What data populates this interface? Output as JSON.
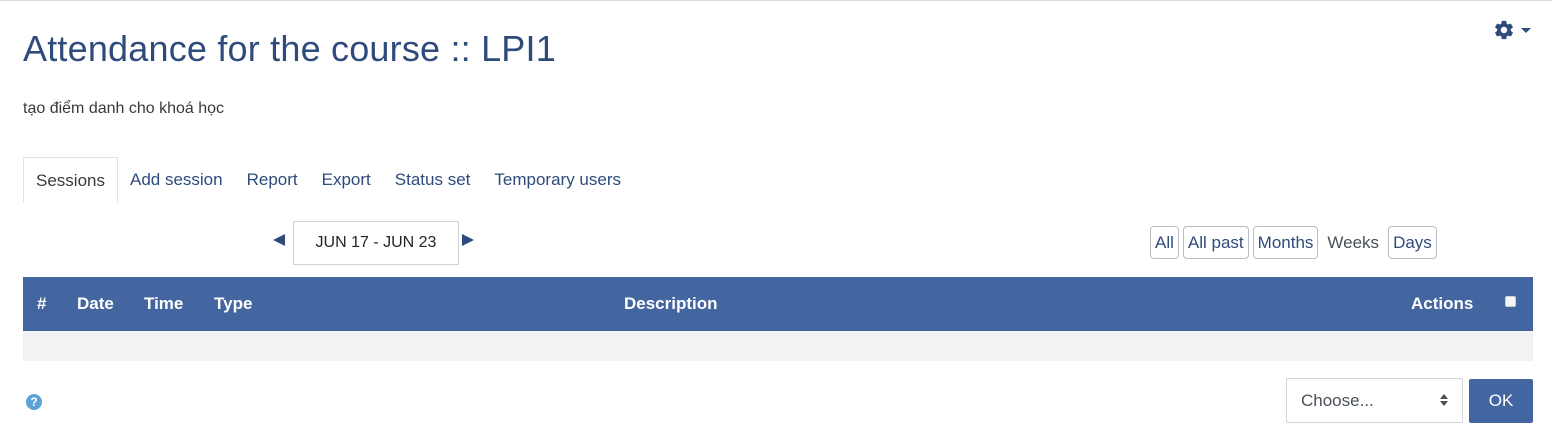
{
  "page": {
    "title": "Attendance for the course :: LPI1",
    "subtitle": "tạo điểm danh cho khoá học"
  },
  "tabs": [
    {
      "label": "Sessions",
      "active": true
    },
    {
      "label": "Add session"
    },
    {
      "label": "Report"
    },
    {
      "label": "Export"
    },
    {
      "label": "Status set"
    },
    {
      "label": "Temporary users"
    }
  ],
  "date_nav": {
    "current_range": "JUN 17 - JUN 23"
  },
  "view_options": {
    "all": "All",
    "all_past": "All past",
    "months": "Months",
    "weeks": "Weeks",
    "days": "Days",
    "selected": "Weeks"
  },
  "table": {
    "columns": [
      "#",
      "Date",
      "Time",
      "Type",
      "Description",
      "Actions"
    ],
    "rows": []
  },
  "bulk_action": {
    "select_value": "Choose...",
    "ok_label": "OK"
  },
  "colors": {
    "accent": "#4466a0",
    "title": "#2f4b7c",
    "help": "#5ba3d6"
  },
  "icons": {
    "settings": "gear-icon",
    "prev": "triangle-left-icon",
    "next": "triangle-right-icon",
    "help": "question-circle-icon"
  }
}
